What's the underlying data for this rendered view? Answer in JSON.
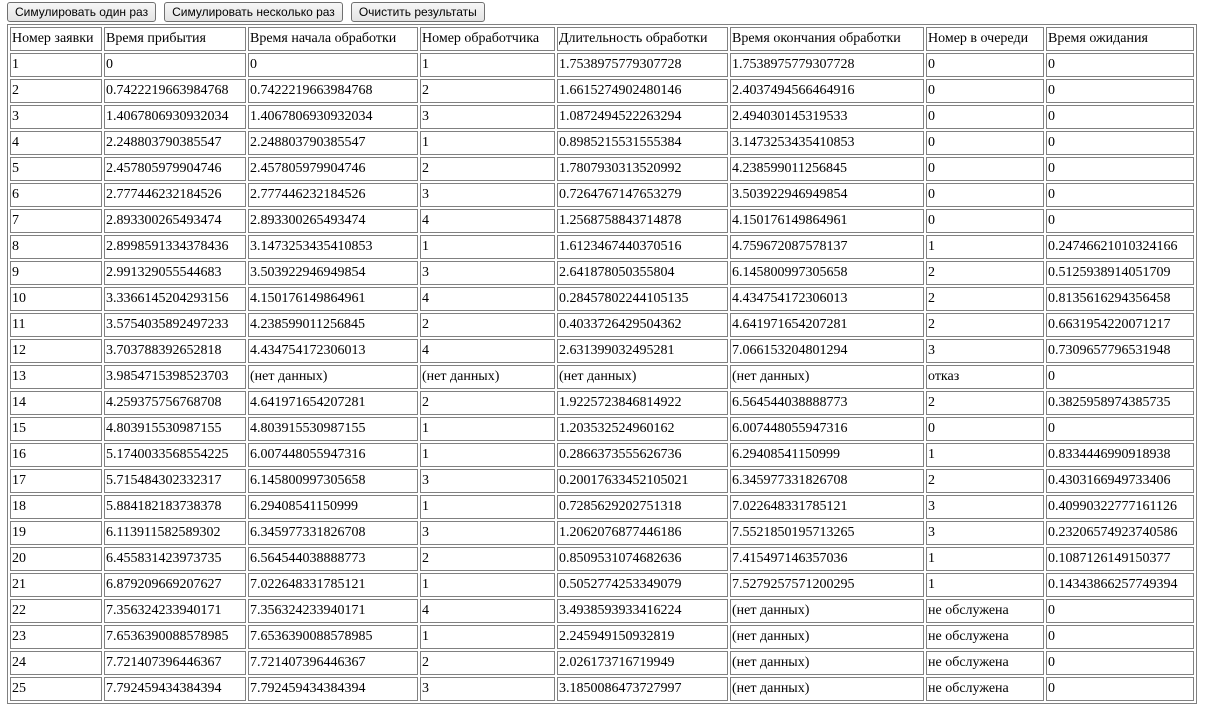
{
  "toolbar": {
    "simulate_once": "Симулировать один раз",
    "simulate_many": "Симулировать несколько раз",
    "clear_results": "Очистить результаты"
  },
  "table": {
    "headers": [
      "Номер заявки",
      "Время прибытия",
      "Время начала обработки",
      "Номер обработчика",
      "Длительность обработки",
      "Время окончания обработки",
      "Номер в очереди",
      "Время ожидания"
    ],
    "rows": [
      [
        "1",
        "0",
        "0",
        "1",
        "1.7538975779307728",
        "1.7538975779307728",
        "0",
        "0"
      ],
      [
        "2",
        "0.7422219663984768",
        "0.7422219663984768",
        "2",
        "1.6615274902480146",
        "2.4037494566464916",
        "0",
        "0"
      ],
      [
        "3",
        "1.4067806930932034",
        "1.4067806930932034",
        "3",
        "1.0872494522263294",
        "2.494030145319533",
        "0",
        "0"
      ],
      [
        "4",
        "2.248803790385547",
        "2.248803790385547",
        "1",
        "0.8985215531555384",
        "3.1473253435410853",
        "0",
        "0"
      ],
      [
        "5",
        "2.457805979904746",
        "2.457805979904746",
        "2",
        "1.7807930313520992",
        "4.238599011256845",
        "0",
        "0"
      ],
      [
        "6",
        "2.777446232184526",
        "2.777446232184526",
        "3",
        "0.7264767147653279",
        "3.503922946949854",
        "0",
        "0"
      ],
      [
        "7",
        "2.893300265493474",
        "2.893300265493474",
        "4",
        "1.2568758843714878",
        "4.150176149864961",
        "0",
        "0"
      ],
      [
        "8",
        "2.8998591334378436",
        "3.1473253435410853",
        "1",
        "1.6123467440370516",
        "4.759672087578137",
        "1",
        "0.24746621010324166"
      ],
      [
        "9",
        "2.991329055544683",
        "3.503922946949854",
        "3",
        "2.641878050355804",
        "6.145800997305658",
        "2",
        "0.5125938914051709"
      ],
      [
        "10",
        "3.3366145204293156",
        "4.150176149864961",
        "4",
        "0.28457802244105135",
        "4.434754172306013",
        "2",
        "0.8135616294356458"
      ],
      [
        "11",
        "3.5754035892497233",
        "4.238599011256845",
        "2",
        "0.4033726429504362",
        "4.641971654207281",
        "2",
        "0.6631954220071217"
      ],
      [
        "12",
        "3.703788392652818",
        "4.434754172306013",
        "4",
        "2.631399032495281",
        "7.066153204801294",
        "3",
        "0.7309657796531948"
      ],
      [
        "13",
        "3.9854715398523703",
        "(нет данных)",
        "(нет данных)",
        "(нет данных)",
        "(нет данных)",
        "отказ",
        "0"
      ],
      [
        "14",
        "4.259375756768708",
        "4.641971654207281",
        "2",
        "1.9225723846814922",
        "6.564544038888773",
        "2",
        "0.3825958974385735"
      ],
      [
        "15",
        "4.803915530987155",
        "4.803915530987155",
        "1",
        "1.203532524960162",
        "6.007448055947316",
        "0",
        "0"
      ],
      [
        "16",
        "5.1740033568554225",
        "6.007448055947316",
        "1",
        "0.2866373555626736",
        "6.29408541150999",
        "1",
        "0.8334446990918938"
      ],
      [
        "17",
        "5.715484302332317",
        "6.145800997305658",
        "3",
        "0.20017633452105021",
        "6.345977331826708",
        "2",
        "0.4303166949733406"
      ],
      [
        "18",
        "5.884182183738378",
        "6.29408541150999",
        "1",
        "0.7285629202751318",
        "7.022648331785121",
        "3",
        "0.40990322777161126"
      ],
      [
        "19",
        "6.113911582589302",
        "6.345977331826708",
        "3",
        "1.2062076877446186",
        "7.5521850195713265",
        "3",
        "0.23206574923740586"
      ],
      [
        "20",
        "6.455831423973735",
        "6.564544038888773",
        "2",
        "0.8509531074682636",
        "7.415497146357036",
        "1",
        "0.1087126149150377"
      ],
      [
        "21",
        "6.879209669207627",
        "7.022648331785121",
        "1",
        "0.5052774253349079",
        "7.5279257571200295",
        "1",
        "0.14343866257749394"
      ],
      [
        "22",
        "7.356324233940171",
        "7.356324233940171",
        "4",
        "3.4938593933416224",
        "(нет данных)",
        "не обслужена",
        "0"
      ],
      [
        "23",
        "7.6536390088578985",
        "7.6536390088578985",
        "1",
        "2.245949150932819",
        "(нет данных)",
        "не обслужена",
        "0"
      ],
      [
        "24",
        "7.721407396446367",
        "7.721407396446367",
        "2",
        "2.026173716719949",
        "(нет данных)",
        "не обслужена",
        "0"
      ],
      [
        "25",
        "7.792459434384394",
        "7.792459434384394",
        "3",
        "3.1850086473727997",
        "(нет данных)",
        "не обслужена",
        "0"
      ]
    ]
  }
}
